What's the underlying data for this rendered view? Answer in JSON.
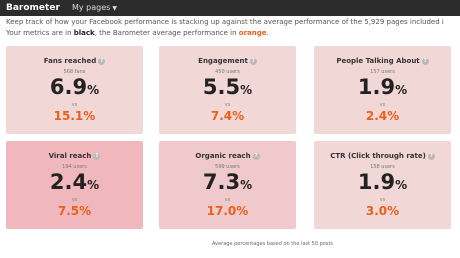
{
  "topbar": {
    "brand": "Barometer",
    "menu_label": "My pages"
  },
  "intro": {
    "line1": "Keep track of how your Facebook performance is stacking up against the average performance of the 5,929 pages included i",
    "line2_a": "Your metrics are in ",
    "line2_black": "black",
    "line2_b": ", the Barometer average performance in ",
    "line2_orange": "orange",
    "line2_c": "."
  },
  "cards": [
    {
      "title": "Fans reached",
      "count": "568 fans",
      "value": "6.9",
      "vs": "vs",
      "benchmark": "15.1%"
    },
    {
      "title": "Engagement",
      "count": "450 users",
      "value": "5.5",
      "vs": "vs",
      "benchmark": "7.4%"
    },
    {
      "title": "People Talking About",
      "count": "157 users",
      "value": "1.9",
      "vs": "vs",
      "benchmark": "2.4%"
    },
    {
      "title": "Viral reach",
      "count": "194 users",
      "value": "2.4",
      "vs": "vs",
      "benchmark": "7.5%"
    },
    {
      "title": "Organic reach",
      "count": "599 users",
      "value": "7.3",
      "vs": "vs",
      "benchmark": "17.0%"
    },
    {
      "title": "CTR (Click through rate)",
      "count": "158 users",
      "value": "1.9",
      "vs": "vs",
      "benchmark": "3.0%"
    }
  ],
  "percent_sign": "%",
  "help_glyph": "?",
  "footnote": "Average percentages based on the last 50 posts",
  "colors": {
    "topbar": "#2c2c2c",
    "benchmark_orange": "#e8601c",
    "card_light": "#f2d7d7",
    "card_mid": "#efc9cb",
    "card_strong": "#f0b8bc"
  },
  "icons": {
    "help": "help-circle-icon",
    "dropdown": "caret-down-icon"
  }
}
